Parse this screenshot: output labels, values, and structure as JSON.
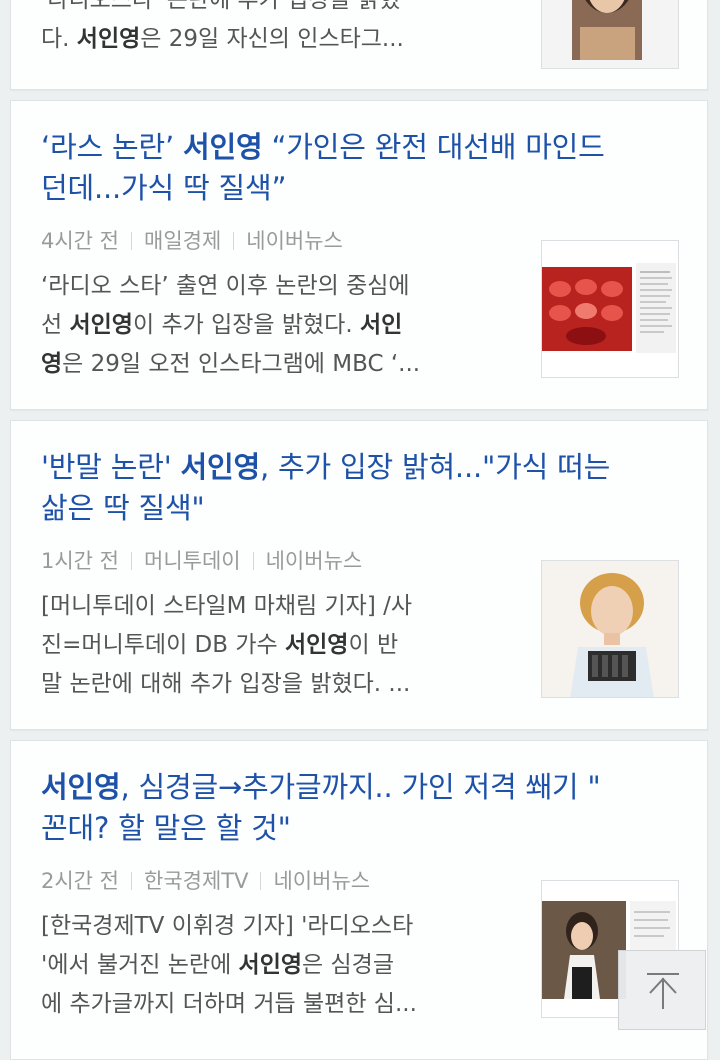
{
  "article0": {
    "summary_line1": "'라디오스타' 논란에 추가 입장을 밝혔",
    "summary_line2_prefix": "다. ",
    "summary_line2_kw": "서인영",
    "summary_line2_suffix": "은 29일 자신의 인스타그..."
  },
  "article1": {
    "title_pre": "‘라스 논란’ ",
    "title_kw": "서인영",
    "title_post": " “가인은 완전 대선배 마인드",
    "title_line2": "던데...가식 딱 질색”",
    "time": "4시간 전",
    "source": "매일경제",
    "portal": "네이버뉴스",
    "summary_line1": "‘라디오 스타’ 출연 이후 논란의 중심에",
    "summary_line2_pre": "선 ",
    "summary_line2_kw1": "서인영",
    "summary_line2_mid": "이 추가 입장을 밝혔다. ",
    "summary_line2_kw2": "서인",
    "summary_line3_kw": "영",
    "summary_line3_post": "은 29일 오전 인스타그램에 MBC ‘..."
  },
  "article2": {
    "title_pre": "'반말 논란' ",
    "title_kw": "서인영",
    "title_post": ", 추가 입장 밝혀...\"가식 떠는",
    "title_line2": "삶은 딱 질색\"",
    "time": "1시간 전",
    "source": "머니투데이",
    "portal": "네이버뉴스",
    "summary_line1": "[머니투데이 스타일M 마채림 기자] /사",
    "summary_line2_pre": "진=머니투데이 DB 가수 ",
    "summary_line2_kw": "서인영",
    "summary_line2_post": "이 반",
    "summary_line3": "말 논란에 대해 추가 입장을 밝혔다. ..."
  },
  "article3": {
    "title_kw": "서인영",
    "title_post": ", 심경글→추가글까지.. 가인 저격 쐐기 \"",
    "title_line2": "꼰대? 할 말은 할 것\"",
    "time": "2시간 전",
    "source": "한국경제TV",
    "portal": "네이버뉴스",
    "summary_line1": "[한국경제TV 이휘경 기자] '라디오스타",
    "summary_line2_pre": "'에서 불거진 논란에 ",
    "summary_line2_kw": "서인영",
    "summary_line2_post": "은 심경글",
    "summary_line3": "에 추가글까지 더하며 거듭 불편한 심..."
  },
  "colors": {
    "title": "#1e52a8",
    "summary": "#555555",
    "meta": "#9a9a9a",
    "background": "#edf0f0"
  }
}
